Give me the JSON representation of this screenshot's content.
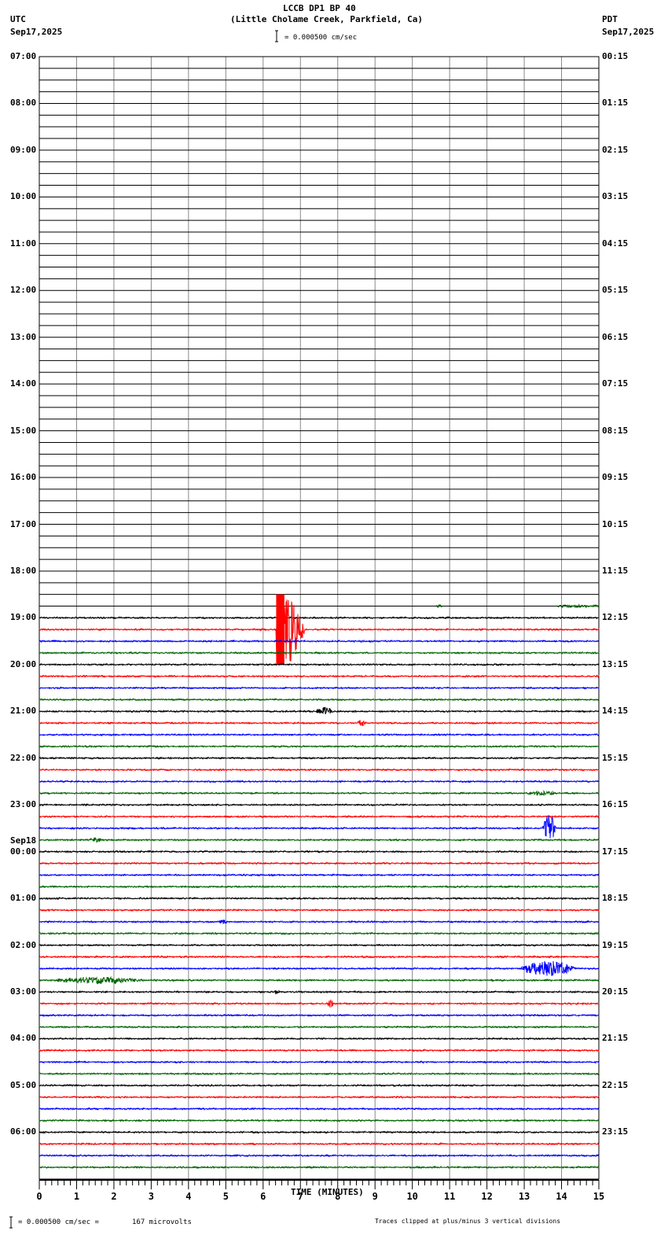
{
  "chart_data": {
    "type": "line",
    "title": "LCCB DP1 BP 40",
    "subtitle": "(Little Cholame Creek, Parkfield, Ca)",
    "left_timezone": "UTC",
    "left_date": "Sep17,2025",
    "right_timezone": "PDT",
    "right_date": "Sep17,2025",
    "scale_label": "= 0.000500 cm/sec",
    "xlabel": "TIME (MINUTES)",
    "xlim": [
      0,
      15
    ],
    "x_ticks": [
      "0",
      "1",
      "2",
      "3",
      "4",
      "5",
      "6",
      "7",
      "8",
      "9",
      "10",
      "11",
      "12",
      "13",
      "14",
      "15"
    ],
    "traces_per_hour": 4,
    "trace_colors": [
      "#000000",
      "#ff0000",
      "#0000ff",
      "#006400"
    ],
    "left_labels": [
      "07:00",
      "08:00",
      "09:00",
      "10:00",
      "11:00",
      "12:00",
      "13:00",
      "14:00",
      "15:00",
      "16:00",
      "17:00",
      "18:00",
      "19:00",
      "20:00",
      "21:00",
      "22:00",
      "23:00",
      "00:00",
      "01:00",
      "02:00",
      "03:00",
      "04:00",
      "05:00",
      "06:00"
    ],
    "date_change_label": "Sep18",
    "right_labels": [
      "00:15",
      "01:15",
      "02:15",
      "03:15",
      "04:15",
      "05:15",
      "06:15",
      "07:15",
      "08:15",
      "09:15",
      "10:15",
      "11:15",
      "12:15",
      "13:15",
      "14:15",
      "15:15",
      "16:15",
      "17:15",
      "18:15",
      "19:15",
      "20:15",
      "21:15",
      "22:15",
      "23:15"
    ],
    "data_start_row": 48,
    "partial_row": {
      "row": 47,
      "segments": [
        [
          10.65,
          10.8
        ],
        [
          13.9,
          15
        ]
      ]
    },
    "events": [
      {
        "row": 49,
        "start": 6.35,
        "end": 7.1,
        "amplitude_divisions": 3.0,
        "clipped": true
      },
      {
        "row": 56,
        "start": 7.4,
        "end": 8.1,
        "amplitude_divisions": 0.35
      },
      {
        "row": 57,
        "start": 8.5,
        "end": 8.9,
        "amplitude_divisions": 0.3
      },
      {
        "row": 63,
        "start": 13.0,
        "end": 14.3,
        "amplitude_divisions": 0.2
      },
      {
        "row": 66,
        "start": 13.5,
        "end": 14.0,
        "amplitude_divisions": 1.3
      },
      {
        "row": 67,
        "start": 1.3,
        "end": 1.9,
        "amplitude_divisions": 0.2
      },
      {
        "row": 74,
        "start": 4.8,
        "end": 5.2,
        "amplitude_divisions": 0.2
      },
      {
        "row": 78,
        "start": 12.9,
        "end": 15.0,
        "amplitude_divisions": 0.7
      },
      {
        "row": 79,
        "start": 0.3,
        "end": 4.0,
        "amplitude_divisions": 0.3
      },
      {
        "row": 80,
        "start": 6.3,
        "end": 6.5,
        "amplitude_divisions": 0.25
      },
      {
        "row": 81,
        "start": 7.7,
        "end": 8.0,
        "amplitude_divisions": 0.35
      }
    ],
    "footer_scale": "= 0.000500 cm/sec =",
    "footer_microvolts": "167 microvolts",
    "footer_clip_note": "Traces clipped at plus/minus 3 vertical divisions"
  }
}
